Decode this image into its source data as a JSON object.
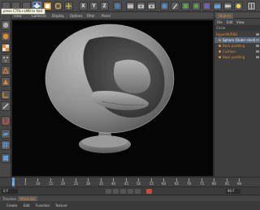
{
  "tooltip": "press CTRL+LMB to fold",
  "toolbar": {
    "axis_x": "X",
    "axis_y": "Y",
    "axis_z": "Z"
  },
  "viewport": {
    "menu": [
      "View",
      "Cameras",
      "Display",
      "Options",
      "Filter",
      "Panel"
    ]
  },
  "objects_panel": {
    "tab_label": "Objects",
    "menu": [
      "File",
      "Edit",
      "View"
    ],
    "header": "Circle",
    "items": [
      {
        "label": "HyperNURBS",
        "selected": false
      },
      {
        "label": "Sphere (Outer shell)",
        "selected": true
      },
      {
        "label": "Back padding",
        "selected": false
      },
      {
        "label": "Cushion",
        "selected": false
      },
      {
        "label": "Back padding",
        "selected": false
      }
    ]
  },
  "timeline": {
    "ticks": [
      "0",
      "5",
      "10",
      "15",
      "20",
      "25",
      "30",
      "35",
      "40",
      "45",
      "50",
      "55",
      "60",
      "65",
      "70",
      "75",
      "80",
      "85",
      "90"
    ],
    "current_frame": "0 F",
    "end_frame": "90 F"
  },
  "bottom": {
    "tabs": [
      {
        "label": "Timeline",
        "active": false
      },
      {
        "label": "Materials",
        "active": true
      }
    ],
    "menu": [
      "Create",
      "Edit",
      "Function",
      "Texture"
    ]
  },
  "colors": {
    "accent": "#e38a2c",
    "selection": "#53647b",
    "playhead": "#55a0e6"
  }
}
